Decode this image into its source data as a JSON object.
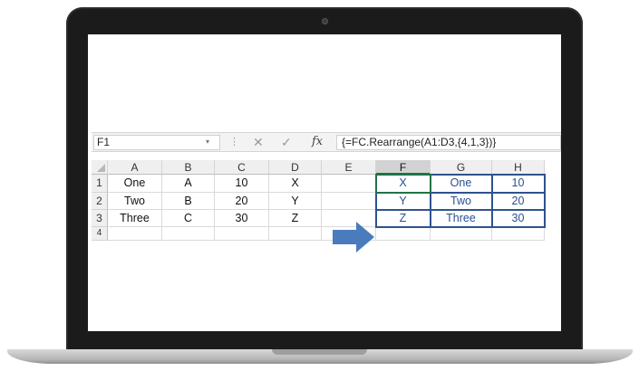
{
  "formula_bar": {
    "name_box": "F1",
    "dropdown_glyph": "▾",
    "separator_glyph": "⋮",
    "cancel_glyph": "✕",
    "enter_glyph": "✓",
    "fx_label": "fx",
    "formula": "{=FC.Rearrange(A1:D3,{4,1,3})}"
  },
  "columns": [
    "A",
    "B",
    "C",
    "D",
    "E",
    "F",
    "G",
    "H"
  ],
  "rows": [
    "1",
    "2",
    "3",
    "4"
  ],
  "source_cells": [
    [
      "One",
      "A",
      "10",
      "X"
    ],
    [
      "Two",
      "B",
      "20",
      "Y"
    ],
    [
      "Three",
      "C",
      "30",
      "Z"
    ]
  ],
  "output_cells": [
    [
      "X",
      "One",
      "10"
    ],
    [
      "Y",
      "Two",
      "20"
    ],
    [
      "Z",
      "Three",
      "30"
    ]
  ],
  "selected_column": "F",
  "colors": {
    "output_text": "#2c4f91",
    "output_border": "#2e528f",
    "arrow": "#4a7bbd",
    "selection": "#217346"
  }
}
